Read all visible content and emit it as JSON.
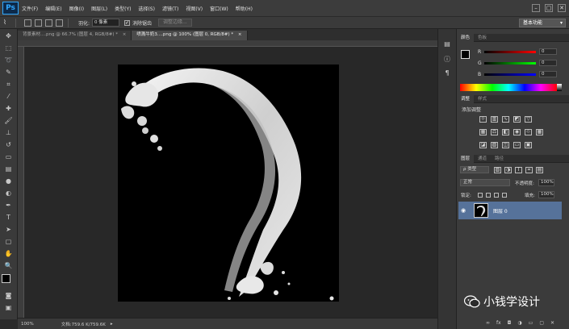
{
  "app": {
    "logo": "Ps"
  },
  "menu": [
    "文件(F)",
    "编辑(E)",
    "图像(I)",
    "图层(L)",
    "类型(Y)",
    "选择(S)",
    "滤镜(T)",
    "视图(V)",
    "窗口(W)",
    "帮助(H)"
  ],
  "window_controls": {
    "minimize": "–",
    "maximize": "▢",
    "close": "✕"
  },
  "options": {
    "feather_label": "羽化:",
    "feather_value": "0 像素",
    "antialias_checked": "✓",
    "antialias_label": "消除锯齿",
    "refine_edge": "调整边缘...",
    "workspace": "基本功能"
  },
  "tabs": [
    {
      "label": "背景素材....png @ 66.7% (图层 4, RGB/8#) *",
      "close": "×"
    },
    {
      "label": "喷溅牛奶3....png @ 100% (图层 0, RGB/8#) *",
      "close": "×"
    }
  ],
  "status": {
    "zoom": "100%",
    "doc": "文档:759.6 K/759.6K"
  },
  "color_panel": {
    "tabs": [
      "颜色",
      "色板"
    ],
    "r_label": "R",
    "g_label": "G",
    "b_label": "B",
    "r": "0",
    "g": "0",
    "b": "0"
  },
  "adjust_panel": {
    "tabs": [
      "调整",
      "样式"
    ],
    "title": "添加调整"
  },
  "layers_panel": {
    "tabs": [
      "图层",
      "通道",
      "路径"
    ],
    "filter": "ρ 类型",
    "blend": "正常",
    "opacity_label": "不透明度:",
    "opacity": "100%",
    "lock_label": "锁定:",
    "fill_label": "填充:",
    "fill": "100%",
    "layer_name": "图层 0"
  },
  "watermark": {
    "text": "小钱学设计"
  },
  "colors": {
    "accent": "#31a8ff",
    "layer_selected": "#56729a",
    "canvas": "#000000"
  }
}
